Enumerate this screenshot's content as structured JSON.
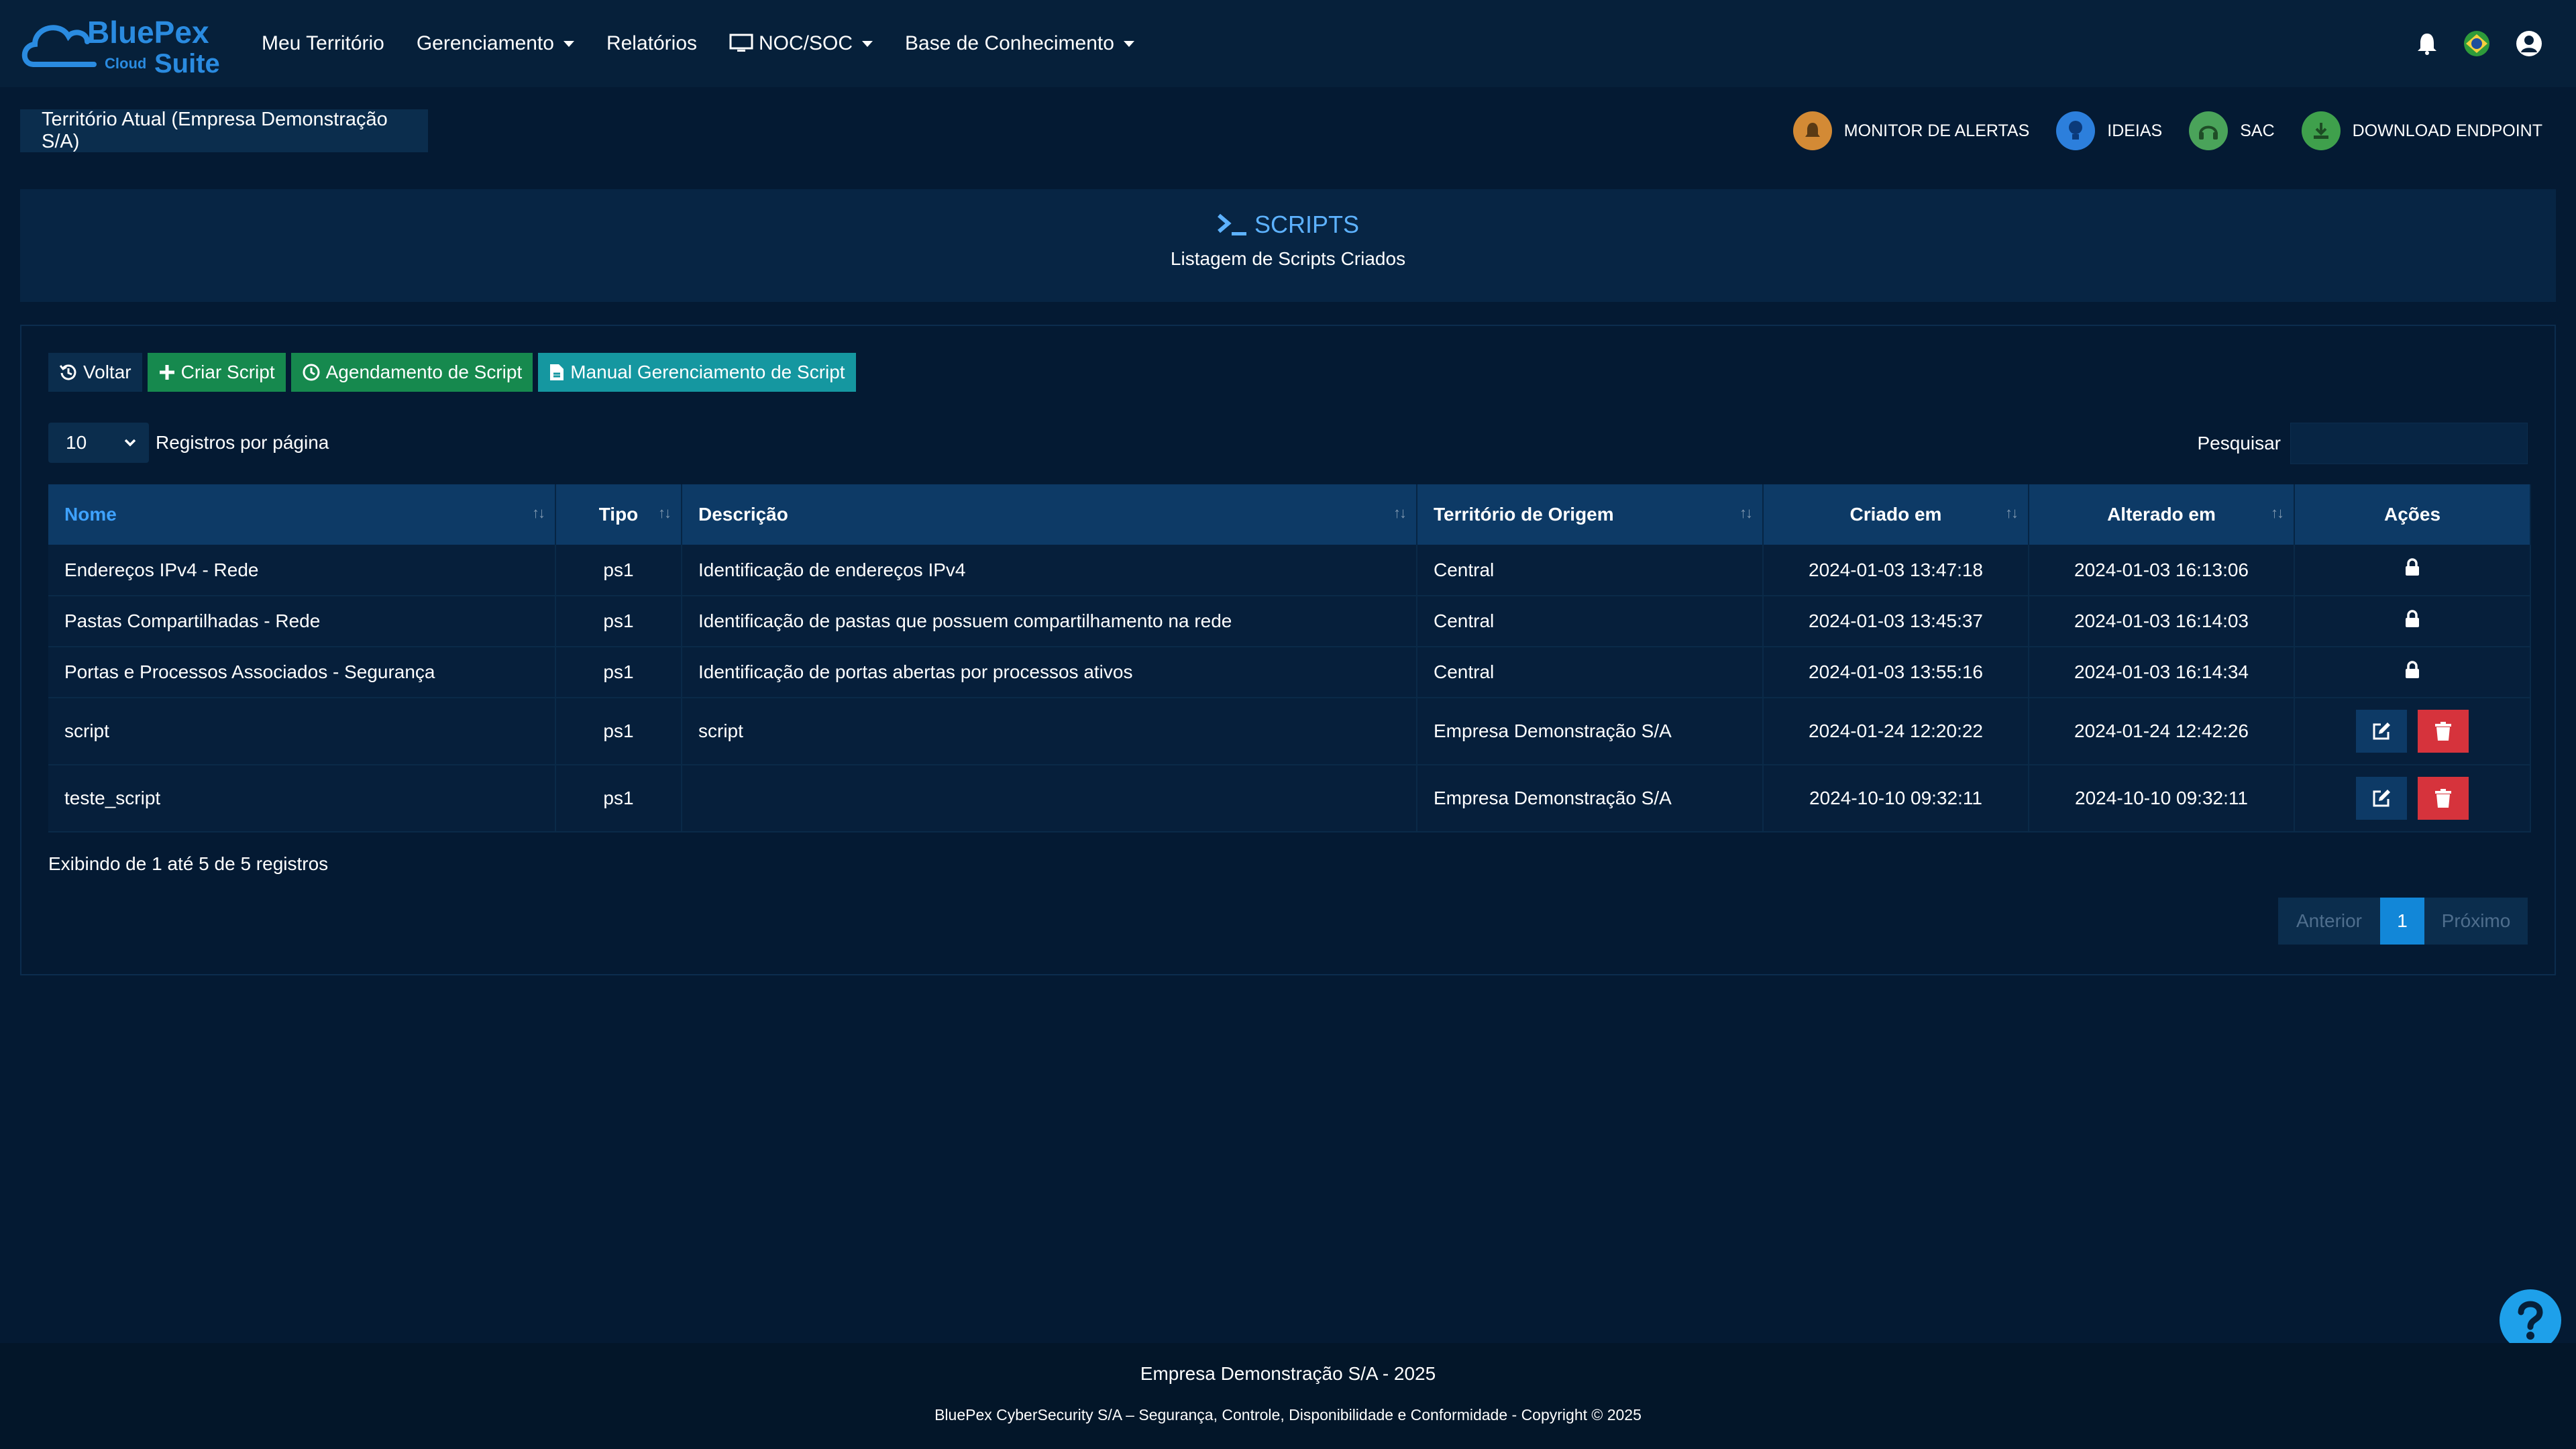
{
  "brand": {
    "name_top": "BluePex",
    "name_mid": "Cloud",
    "name_bottom": "Suite"
  },
  "nav": {
    "items": [
      {
        "label": "Meu Território",
        "dropdown": false
      },
      {
        "label": "Gerenciamento",
        "dropdown": true
      },
      {
        "label": "Relatórios",
        "dropdown": false
      },
      {
        "label": "NOC/SOC",
        "dropdown": true,
        "icon": "monitor-icon"
      },
      {
        "label": "Base de Conhecimento",
        "dropdown": true
      }
    ],
    "right_icons": [
      "bell-icon",
      "brazil-flag-icon",
      "user-icon"
    ]
  },
  "subbar": {
    "territory": "Território Atual (Empresa Demonstração S/A)",
    "quick_links": [
      {
        "label": "MONITOR DE ALERTAS",
        "icon": "alert-icon",
        "color": "#d38a35"
      },
      {
        "label": "IDEIAS",
        "icon": "lightbulb-icon",
        "color": "#2c7fdc"
      },
      {
        "label": "SAC",
        "icon": "headset-icon",
        "color": "#4aa35a"
      },
      {
        "label": "DOWNLOAD ENDPOINT",
        "icon": "download-icon",
        "color": "#3fa04c"
      }
    ]
  },
  "header": {
    "title": "SCRIPTS",
    "subtitle": "Listagem de Scripts Criados"
  },
  "toolbar": {
    "back": "Voltar",
    "create": "Criar Script",
    "schedule": "Agendamento de Script",
    "manual": "Manual Gerenciamento de Script"
  },
  "table_controls": {
    "page_size": "10",
    "page_size_label": "Registros por página",
    "search_label": "Pesquisar",
    "search_value": ""
  },
  "table": {
    "columns": [
      "Nome",
      "Tipo",
      "Descrição",
      "Território de Origem",
      "Criado em",
      "Alterado em",
      "Ações"
    ],
    "rows": [
      {
        "nome": "Endereços IPv4 - Rede",
        "tipo": "ps1",
        "descricao": "Identificação de endereços IPv4",
        "territorio": "Central",
        "criado": "2024-01-03 13:47:18",
        "alterado": "2024-01-03 16:13:06",
        "locked": true
      },
      {
        "nome": "Pastas Compartilhadas - Rede",
        "tipo": "ps1",
        "descricao": "Identificação de pastas que possuem compartilhamento na rede",
        "territorio": "Central",
        "criado": "2024-01-03 13:45:37",
        "alterado": "2024-01-03 16:14:03",
        "locked": true
      },
      {
        "nome": "Portas e Processos Associados - Segurança",
        "tipo": "ps1",
        "descricao": "Identificação de portas abertas por processos ativos",
        "territorio": "Central",
        "criado": "2024-01-03 13:55:16",
        "alterado": "2024-01-03 16:14:34",
        "locked": true
      },
      {
        "nome": "script",
        "tipo": "ps1",
        "descricao": "script",
        "territorio": "Empresa Demonstração S/A",
        "criado": "2024-01-24 12:20:22",
        "alterado": "2024-01-24 12:42:26",
        "locked": false
      },
      {
        "nome": "teste_script",
        "tipo": "ps1",
        "descricao": "",
        "territorio": "Empresa Demonstração S/A",
        "criado": "2024-10-10 09:32:11",
        "alterado": "2024-10-10 09:32:11",
        "locked": false
      }
    ]
  },
  "info": "Exibindo de 1 até 5 de 5 registros",
  "pager": {
    "prev": "Anterior",
    "current": "1",
    "next": "Próximo"
  },
  "footer": {
    "company": "Empresa Demonstração S/A - 2025",
    "copyright": "BluePex CyberSecurity S/A – Segurança, Controle, Disponibilidade e Conformidade - Copyright © 2025"
  }
}
